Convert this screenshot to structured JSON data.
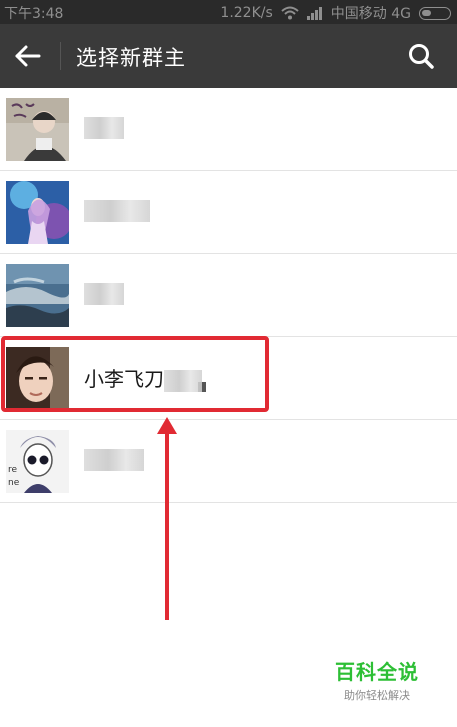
{
  "status_bar": {
    "time": "下午3:48",
    "speed": "1.22K/s",
    "carrier": "中国移动 4G"
  },
  "header": {
    "title": "选择新群主"
  },
  "contacts": [
    {
      "name": ""
    },
    {
      "name": ""
    },
    {
      "name": ""
    },
    {
      "name": "小李飞刀"
    },
    {
      "name": ""
    }
  ],
  "annotation": {
    "highlight_color": "#e12a33"
  },
  "watermark": {
    "title": "百科全说",
    "subtitle": "助你轻松解决"
  }
}
